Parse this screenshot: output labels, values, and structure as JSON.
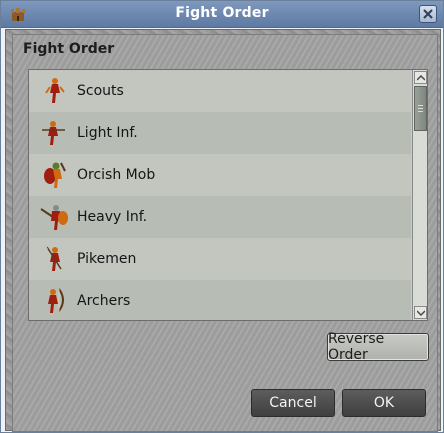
{
  "window": {
    "title": "Fight Order",
    "app_icon": "castle-icon",
    "close_icon": "close-icon"
  },
  "panel": {
    "title": "Fight Order"
  },
  "units": [
    {
      "label": "Scouts",
      "icon": "scout-unit-icon"
    },
    {
      "label": "Light Inf.",
      "icon": "light-infantry-unit-icon"
    },
    {
      "label": "Orcish Mob",
      "icon": "orcish-mob-unit-icon"
    },
    {
      "label": "Heavy Inf.",
      "icon": "heavy-infantry-unit-icon"
    },
    {
      "label": "Pikemen",
      "icon": "pikemen-unit-icon"
    },
    {
      "label": "Archers",
      "icon": "archers-unit-icon"
    }
  ],
  "buttons": {
    "reverse": "Reverse Order",
    "cancel": "Cancel",
    "ok": "OK"
  },
  "colors": {
    "titlebar": "#5d7aa3",
    "unit_orange": "#d06a12",
    "unit_red": "#a01e10"
  }
}
